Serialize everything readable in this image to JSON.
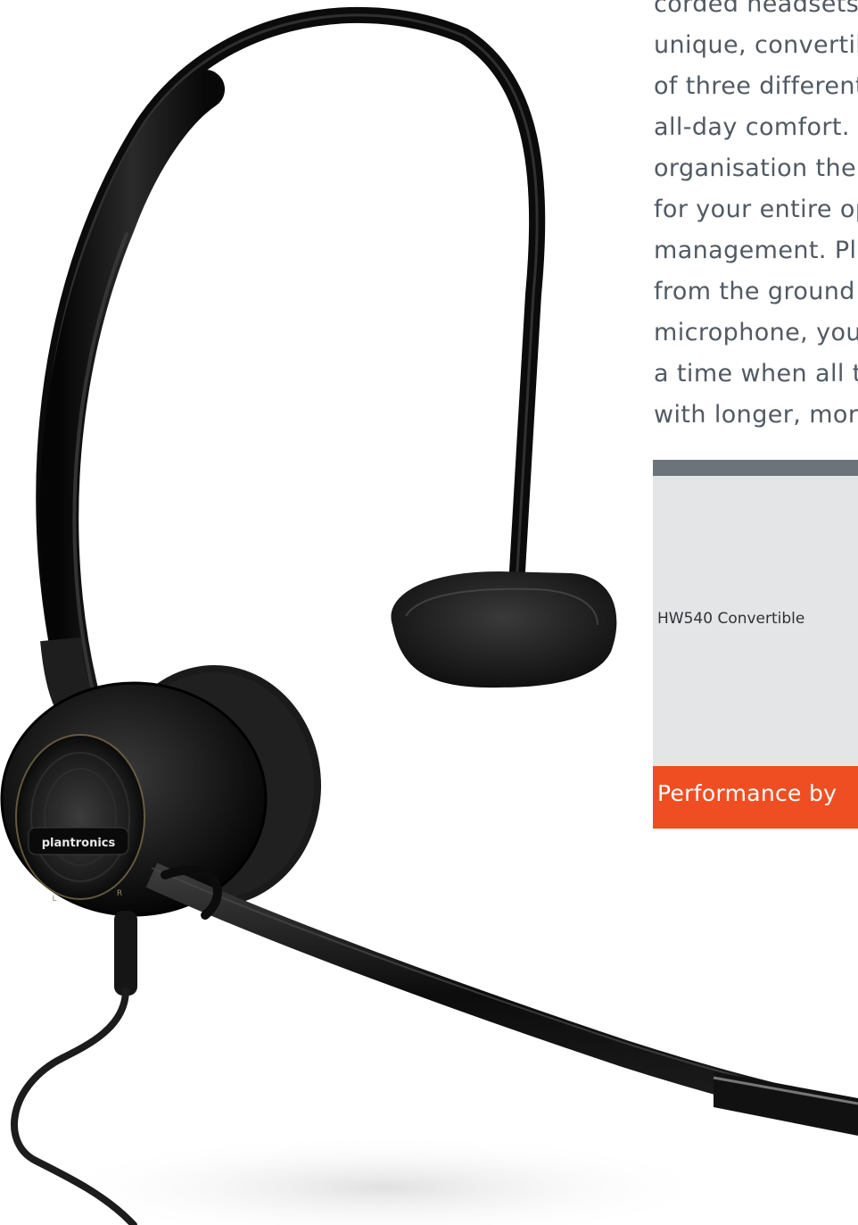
{
  "body_text": {
    "lines": [
      "corded headsets w",
      "unique, convertible",
      "of three different w",
      "all-day comfort. A",
      "organisation the fle",
      "for your entire ope",
      "management. Plus",
      "from the ground u",
      "microphone, you c",
      "a time when all th",
      "with longer, more"
    ]
  },
  "product_panel": {
    "product_name": "HW540 Convertible",
    "footer_text": "Performance by"
  },
  "headset_image": {
    "brand_logo": "plantronics",
    "channel_marks": [
      "L",
      "R"
    ]
  },
  "colors": {
    "accent": "#ef4e23",
    "panel_bg": "#e4e5e7",
    "panel_bar": "#6c737b",
    "body_text": "#515a63"
  }
}
